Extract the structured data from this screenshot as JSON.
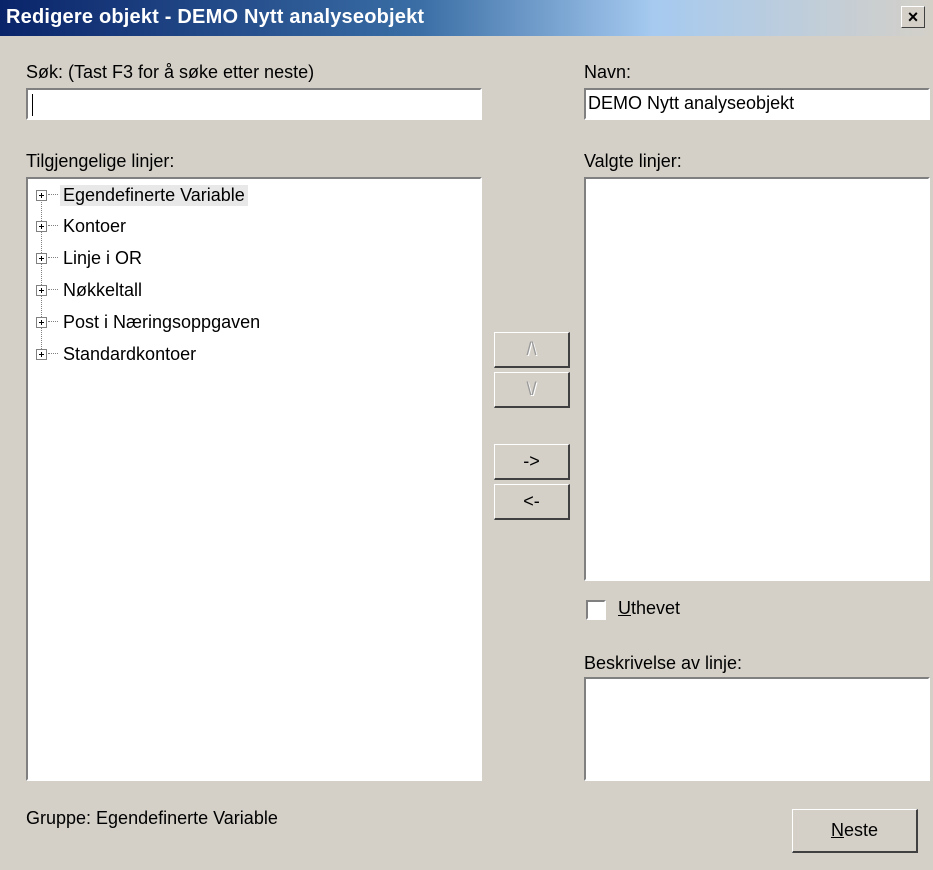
{
  "window": {
    "title": "Redigere objekt - DEMO Nytt analyseobjekt",
    "close_glyph": "×"
  },
  "search": {
    "label": "Søk:  (Tast F3 for å søke etter neste)",
    "value": ""
  },
  "name": {
    "label": "Navn:",
    "value": "DEMO Nytt analyseobjekt"
  },
  "available": {
    "label": "Tilgjengelige linjer:",
    "items": [
      {
        "label": "Egendefinerte Variable",
        "selected": true
      },
      {
        "label": "Kontoer",
        "selected": false
      },
      {
        "label": "Linje i OR",
        "selected": false
      },
      {
        "label": "Nøkkeltall",
        "selected": false
      },
      {
        "label": "Post i Næringsoppgaven",
        "selected": false
      },
      {
        "label": "Standardkontoer",
        "selected": false
      }
    ]
  },
  "selected_lines": {
    "label": "Valgte linjer:"
  },
  "buttons": {
    "move_up": "/\\",
    "move_down": "\\/",
    "add": "->",
    "remove": "<-",
    "next_mnemonic": "N",
    "next_rest": "este"
  },
  "highlight": {
    "mnemonic": "U",
    "rest": "thevet",
    "checked": false
  },
  "description": {
    "label": "Beskrivelse av linje:"
  },
  "status": {
    "group_text": "Gruppe: Egendefinerte Variable"
  },
  "icons": {
    "close": "close-icon",
    "tree_expand": "plus-box-icon"
  },
  "colors": {
    "title_start": "#0a246a",
    "dialog_bg": "#d4d0c8",
    "tree_selection": "#e8e8e8"
  }
}
